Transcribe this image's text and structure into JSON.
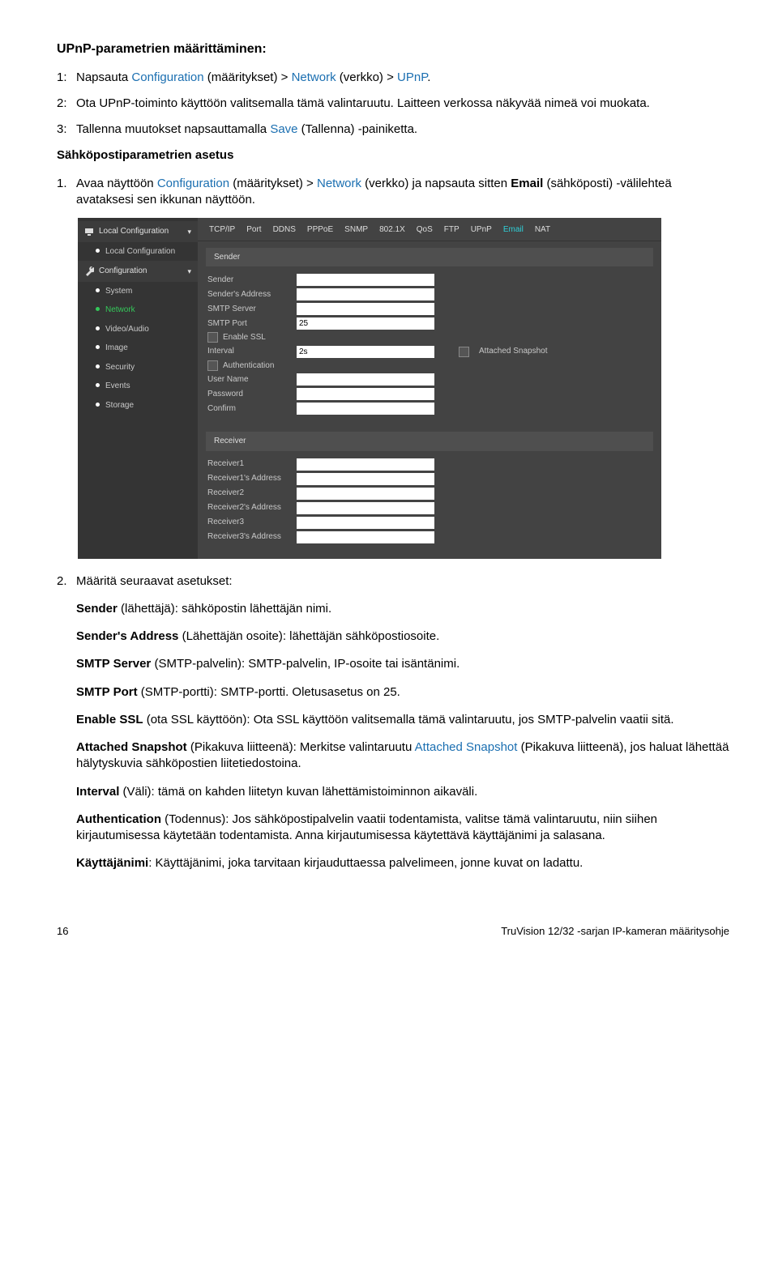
{
  "heading": "UPnP-parametrien määrittäminen:",
  "steps_top": {
    "s1": {
      "n": "1:",
      "pre": "Napsauta ",
      "conf": "Configuration",
      "conf_tail": " (määritykset) > ",
      "net": "Network",
      "net_tail": " (verkko) > ",
      "upnp": "UPnP",
      "tail": "."
    },
    "s2": {
      "n": "2:",
      "text": "Ota UPnP-toiminto käyttöön valitsemalla tämä valintaruutu. Laitteen verkossa näkyvää nimeä voi muokata."
    },
    "s3": {
      "n": "3:",
      "pre": "Tallenna muutokset napsauttamalla ",
      "save": "Save",
      "tail": " (Tallenna) -painiketta."
    }
  },
  "sub_h": "Sähköpostiparametrien asetus",
  "step1": {
    "n": "1.",
    "pre": "Avaa näyttöön ",
    "conf": "Configuration",
    "conf_tail": " (määritykset) > ",
    "net": "Network",
    "mid": " (verkko) ja napsauta sitten ",
    "email_b": "Email",
    "tail": " (sähköposti) -välilehteä avataksesi sen ikkunan näyttöön."
  },
  "scr": {
    "side": {
      "h1": "Local Configuration",
      "i1": "Local Configuration",
      "h2": "Configuration",
      "items": [
        "System",
        "Network",
        "Video/Audio",
        "Image",
        "Security",
        "Events",
        "Storage"
      ],
      "active_index": 1
    },
    "tabs": [
      "TCP/IP",
      "Port",
      "DDNS",
      "PPPoE",
      "SNMP",
      "802.1X",
      "QoS",
      "FTP",
      "UPnP",
      "Email",
      "NAT"
    ],
    "tabs_active_index": 9,
    "sender_bar": "Sender",
    "rows": {
      "sender": "Sender",
      "s_addr": "Sender's Address",
      "smtp_server": "SMTP Server",
      "smtp_port": "SMTP Port",
      "smtp_port_val": "25",
      "enable_ssl": "Enable SSL",
      "interval": "Interval",
      "interval_val": "2s",
      "attached": "Attached Snapshot",
      "auth": "Authentication",
      "user": "User Name",
      "pass": "Password",
      "confirm": "Confirm"
    },
    "receiver_bar": "Receiver",
    "receivers": [
      "Receiver1",
      "Receiver1's Address",
      "Receiver2",
      "Receiver2's Address",
      "Receiver3",
      "Receiver3's Address"
    ]
  },
  "step2": {
    "n": "2.",
    "intro": "Määritä seuraavat asetukset:",
    "sender": {
      "b": "Sender",
      "t": " (lähettäjä): sähköpostin lähettäjän nimi."
    },
    "s_addr": {
      "b": "Sender's Address",
      "t": " (Lähettäjän osoite): lähettäjän sähköpostiosoite."
    },
    "smtp_srv": {
      "b": "SMTP Server",
      "t": " (SMTP-palvelin): SMTP-palvelin, IP-osoite tai isäntänimi."
    },
    "smtp_port": {
      "b": "SMTP Port",
      "t": " (SMTP-portti): SMTP-portti. Oletusasetus on 25."
    },
    "ssl": {
      "b": "Enable SSL",
      "t": " (ota SSL käyttöön): Ota SSL käyttöön valitsemalla tämä valintaruutu, jos SMTP-palvelin vaatii sitä."
    },
    "attached": {
      "b": "Attached Snapshot",
      "t1": " (Pikakuva liitteenä): Merkitse valintaruutu ",
      "blue": "Attached Snapshot",
      "t2": " (Pikakuva liitteenä), jos haluat lähettää hälytyskuvia sähköpostien liitetiedostoina."
    },
    "interval": {
      "b": "Interval",
      "t": " (Väli): tämä on kahden liitetyn kuvan lähettämistoiminnon aikaväli."
    },
    "auth": {
      "b": "Authentication",
      "t": " (Todennus): Jos sähköpostipalvelin vaatii todentamista, valitse tämä valintaruutu, niin siihen kirjautumisessa käytetään todentamista. Anna kirjautumisessa käytettävä käyttäjänimi ja salasana."
    },
    "user": {
      "b": "Käyttäjänimi",
      "t": ": Käyttäjänimi, joka tarvitaan kirjauduttaessa palvelimeen, jonne kuvat on ladattu."
    }
  },
  "footer": {
    "page": "16",
    "doc": "TruVision 12/32 -sarjan IP-kameran määritysohje"
  }
}
